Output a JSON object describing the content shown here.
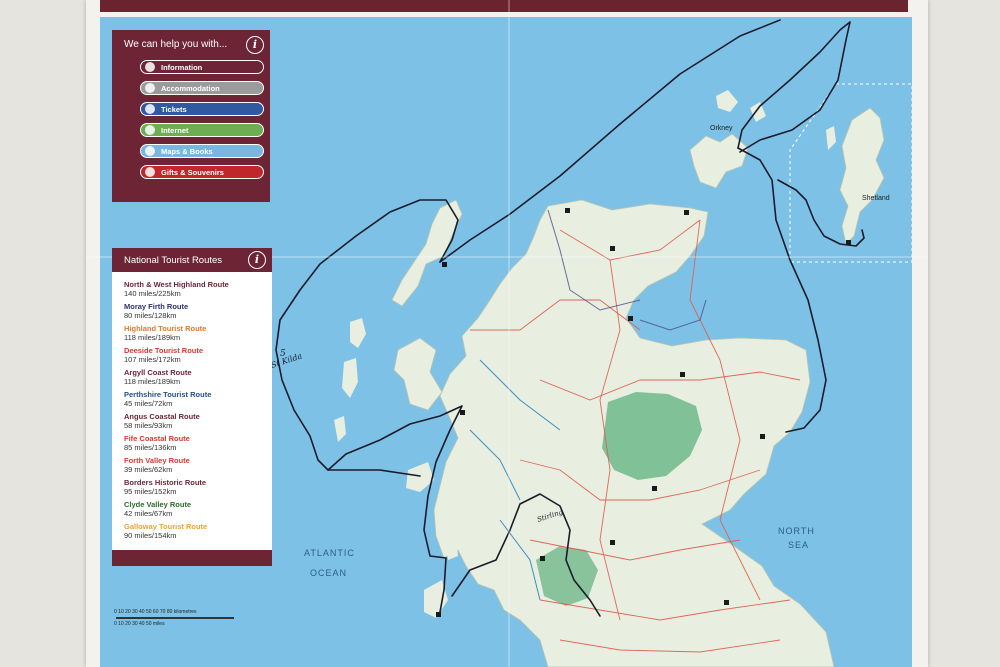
{
  "help_panel": {
    "title": "We can help you with...",
    "items": [
      {
        "label": "Information",
        "color": "#6d2535",
        "icon": "info-icon"
      },
      {
        "label": "Accommodation",
        "color": "#9b9b9b",
        "icon": "bed-icon"
      },
      {
        "label": "Tickets",
        "color": "#2f5aa0",
        "icon": "ticket-icon"
      },
      {
        "label": "Internet",
        "color": "#6dae52",
        "icon": "wifi-icon"
      },
      {
        "label": "Maps & Books",
        "color": "#79b7df",
        "icon": "map-icon"
      },
      {
        "label": "Gifts & Souvenirs",
        "color": "#c0272d",
        "icon": "gift-icon"
      }
    ]
  },
  "routes_panel": {
    "title": "National Tourist Routes",
    "routes": [
      {
        "name": "North & West Highland Route",
        "distance": "140 miles/225km",
        "color": "#6d2535"
      },
      {
        "name": "Moray Firth Route",
        "distance": "80 miles/128km",
        "color": "#2f2f6b"
      },
      {
        "name": "Highland Tourist Route",
        "distance": "118 miles/189km",
        "color": "#e07a2e"
      },
      {
        "name": "Deeside Tourist Route",
        "distance": "107 miles/172km",
        "color": "#d9392f"
      },
      {
        "name": "Argyll Coast Route",
        "distance": "118 miles/189km",
        "color": "#6d2535"
      },
      {
        "name": "Perthshire Tourist Route",
        "distance": "45 miles/72km",
        "color": "#1f4f8a"
      },
      {
        "name": "Angus Coastal Route",
        "distance": "58 miles/93km",
        "color": "#6d2535"
      },
      {
        "name": "Fife Coastal Route",
        "distance": "85 miles/136km",
        "color": "#d9392f"
      },
      {
        "name": "Forth Valley Route",
        "distance": "39 miles/62km",
        "color": "#d9392f"
      },
      {
        "name": "Borders Historic Route",
        "distance": "95 miles/152km",
        "color": "#6d2535"
      },
      {
        "name": "Clyde Valley Route",
        "distance": "42 miles/67km",
        "color": "#2b6b2b"
      },
      {
        "name": "Galloway Tourist Route",
        "distance": "90 miles/154km",
        "color": "#e8a33b"
      }
    ]
  },
  "map_labels": {
    "atlantic_1": "ATLANTIC",
    "atlantic_2": "OCEAN",
    "north_1": "NORTH",
    "north_2": "SEA",
    "orkney": "Orkney",
    "shetland": "Shetland",
    "handwritten_st_kilda": "St Kilda",
    "handwritten_5": "5",
    "handwritten_stirling": "Stirling"
  },
  "scale": {
    "km_ticks": "0   10   20   30   40   50   60   70   80 kilometres",
    "mile_ticks": "0   10   20   30   40   50 miles"
  },
  "colors": {
    "sea": "#7dc2e6",
    "land": "#e8eee0",
    "brand": "#6d2535",
    "national_park": "#6fb88a",
    "hand_route": "#1b1b2a"
  }
}
